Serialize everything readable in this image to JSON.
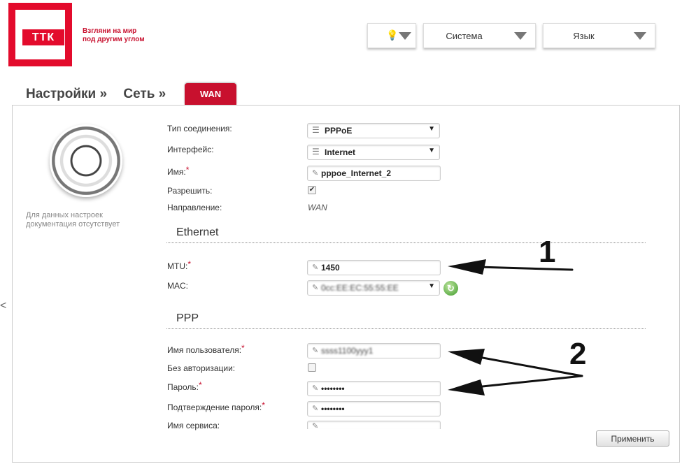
{
  "brand": {
    "logo_text": "ТТК",
    "slogan_line1": "Взгляни на мир",
    "slogan_line2": "под другим углом"
  },
  "top_menu": {
    "tip_icon": "lightbulb-icon",
    "system_label": "Система",
    "language_label": "Язык"
  },
  "breadcrumb": {
    "settings": "Настройки »",
    "network": "Сеть »",
    "active_tab": "WAN"
  },
  "help": {
    "icon": "lifebuoy-icon",
    "note_line1": "Для данных настроек",
    "note_line2": "документация отсутствует"
  },
  "form": {
    "connection_type_label": "Тип соединения:",
    "connection_type_value": "PPPoE",
    "interface_label": "Интерфейс:",
    "interface_value": "Internet",
    "name_label": "Имя:",
    "name_value": "pppoe_Internet_2",
    "enable_label": "Разрешить:",
    "enable_checked": true,
    "direction_label": "Направление:",
    "direction_value": "WAN"
  },
  "ethernet": {
    "section_title": "Ethernet",
    "mtu_label": "MTU:",
    "mtu_value": "1450",
    "mac_label": "MAC:",
    "mac_value": "0cc:EE:EC:55:55:EE"
  },
  "ppp": {
    "section_title": "PPP",
    "username_label": "Имя пользователя:",
    "username_value": "ssss1100yyy1",
    "no_auth_label": "Без авторизации:",
    "no_auth_checked": false,
    "password_label": "Пароль:",
    "password_value": "••••••••",
    "confirm_label": "Подтверждение пароля:",
    "confirm_value": "••••••••",
    "service_label": "Имя сервиса:",
    "service_value": ""
  },
  "actions": {
    "apply_label": "Применить"
  },
  "annotations": {
    "marker_1": "1",
    "marker_2": "2"
  },
  "colors": {
    "brand_red": "#e30b2c",
    "tab_red": "#c8102e",
    "required_star": "#c8102e"
  }
}
